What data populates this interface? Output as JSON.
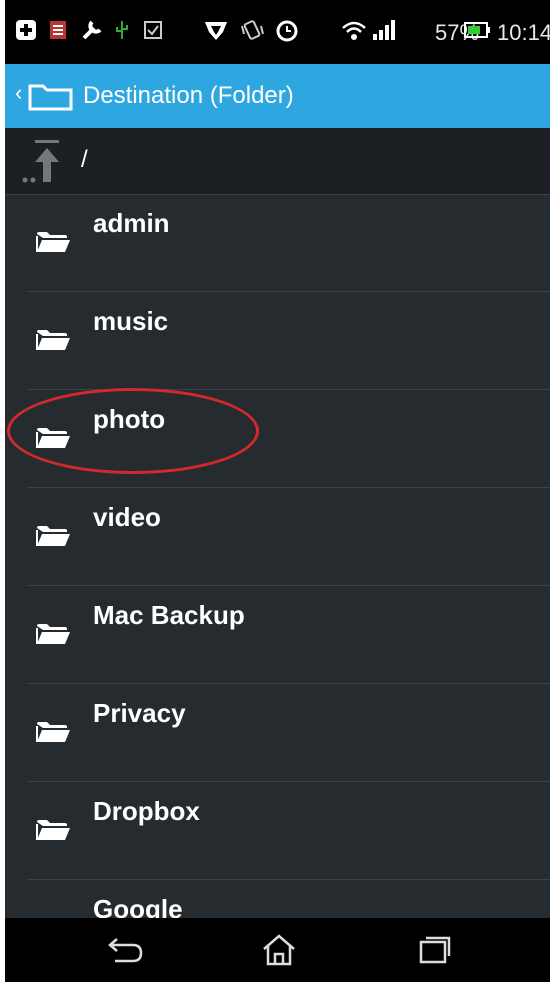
{
  "status_bar": {
    "battery_percent": "57%",
    "time": "10:14",
    "icons": [
      "add-icon",
      "message-icon",
      "wrench-icon",
      "usb-icon",
      "checkbox-icon",
      "heart-shield-icon",
      "vibrate-icon",
      "alarm-icon",
      "wifi-icon",
      "signal-icon",
      "battery-icon"
    ]
  },
  "header": {
    "title": "Destination (Folder)",
    "icons": [
      "back-chevron-icon",
      "folder-icon"
    ]
  },
  "path": {
    "current": "/",
    "up_icon": "folder-up-icon"
  },
  "folders": [
    {
      "name": "admin"
    },
    {
      "name": "music"
    },
    {
      "name": "photo"
    },
    {
      "name": "video"
    },
    {
      "name": "Mac Backup"
    },
    {
      "name": "Privacy"
    },
    {
      "name": "Dropbox"
    },
    {
      "name": "Google"
    }
  ],
  "highlighted_folder": "photo",
  "colors": {
    "action_bar": "#2ea7e0",
    "list_background": "#262b30",
    "highlight_ring": "#d12a2a"
  },
  "nav_bar": {
    "icons": [
      "back-icon",
      "home-icon",
      "recent-apps-icon"
    ]
  }
}
